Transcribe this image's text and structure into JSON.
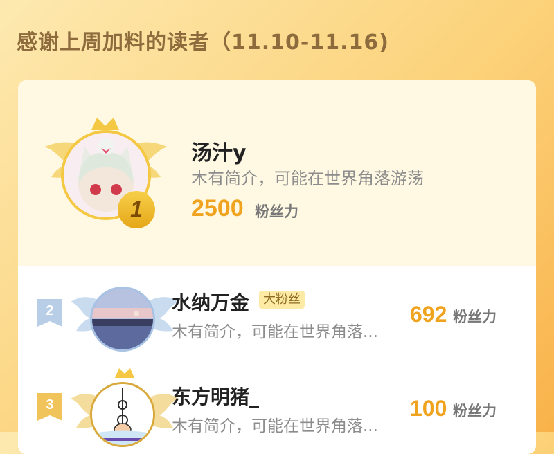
{
  "header": {
    "title": "感谢上周加料的读者（11.10-11.16)"
  },
  "colors": {
    "accent": "#f0a31e",
    "gold": "#f4c843",
    "silver": "#c9dcef"
  },
  "readers": [
    {
      "rank": "1",
      "name": "汤汁y",
      "bio": "木有简介，可能在世界角落游荡",
      "score": "2500",
      "unit": "粉丝力",
      "avatar": "anime-cat-girl"
    },
    {
      "rank": "2",
      "name": "水纳万金",
      "badge": "大粉丝",
      "bio": "木有简介，可能在世界角落...",
      "score": "692",
      "unit": "粉丝力",
      "avatar": "sunset-sea"
    },
    {
      "rank": "3",
      "name": "东方明猪_",
      "bio": "木有简介，可能在世界角落...",
      "score": "100",
      "unit": "粉丝力",
      "avatar": "pearl-tower-pig"
    }
  ]
}
